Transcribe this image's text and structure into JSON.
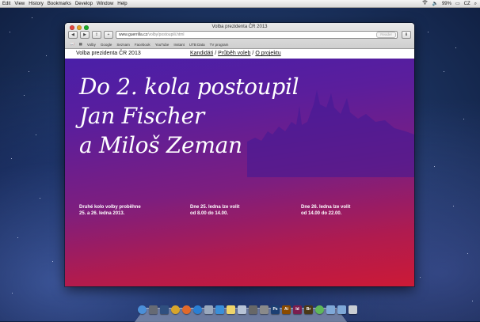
{
  "menubar": {
    "items": [
      "Edit",
      "View",
      "History",
      "Bookmarks",
      "Develop",
      "Window",
      "Help"
    ],
    "status": {
      "volume": "🔈",
      "battery_percent": "99%",
      "battery": "▭",
      "language": "CZ",
      "search": "⌕"
    }
  },
  "browser": {
    "window_title": "Volba prezidenta ČR 2013",
    "url_domain": "www.guerrilla.cz",
    "url_path": "/volby/postoupili.html",
    "reader_label": "Reader",
    "bookmarks": [
      "Volby",
      "Google",
      "Seznam",
      "Facebook",
      "YouTube",
      "Instant",
      "UTB Data",
      "TV program"
    ]
  },
  "site": {
    "title": "Volba prezidenta ČR 2013",
    "nav": [
      "Kandidáti",
      "Průběh voleb",
      "O projektu"
    ],
    "nav_separator": "/",
    "headline": [
      "Do 2. kola postoupil",
      "Jan Fischer",
      "a Miloš Zeman"
    ],
    "info": [
      [
        "Druhé kolo volby proběhne",
        "25. a 26. ledna 2013."
      ],
      [
        "Dne 25. ledna lze volit",
        "od 8.00 do 14.00."
      ],
      [
        "Dne 26. ledna lze volit",
        "od 14.00 do 22.00."
      ]
    ]
  },
  "dock": {
    "icons": [
      {
        "name": "finder-icon",
        "color": "#4b8fd8"
      },
      {
        "name": "launchpad-icon",
        "color": "#666a74"
      },
      {
        "name": "mission-control-icon",
        "color": "#2f4f7f"
      },
      {
        "name": "chrome-icon",
        "color": "#d8a52a"
      },
      {
        "name": "firefox-icon",
        "color": "#e2692a"
      },
      {
        "name": "safari-icon",
        "color": "#2a7fd4"
      },
      {
        "name": "mail-icon",
        "color": "#9aa8bd"
      },
      {
        "name": "itunes-icon",
        "color": "#3a8fd9"
      },
      {
        "name": "notes-icon",
        "color": "#efd46a"
      },
      {
        "name": "preview-icon",
        "color": "#b7c3d6"
      },
      {
        "name": "calculator-icon",
        "color": "#676767"
      },
      {
        "name": "system-preferences-icon",
        "color": "#8a8a8a"
      },
      {
        "name": "photoshop-icon",
        "color": "#1c3f73",
        "label": "Ps"
      },
      {
        "name": "illustrator-icon",
        "color": "#8a4a00",
        "label": "Ai"
      },
      {
        "name": "indesign-icon",
        "color": "#7a1d4f",
        "label": "Id"
      },
      {
        "name": "bridge-icon",
        "color": "#4a3818",
        "label": "Br"
      },
      {
        "name": "messages-icon",
        "color": "#5fb85a"
      },
      {
        "name": "downloads-folder-icon",
        "color": "#7fa8d8"
      },
      {
        "name": "documents-folder-icon",
        "color": "#7fa8d8"
      },
      {
        "name": "trash-icon",
        "color": "#c9cdd3"
      }
    ]
  }
}
